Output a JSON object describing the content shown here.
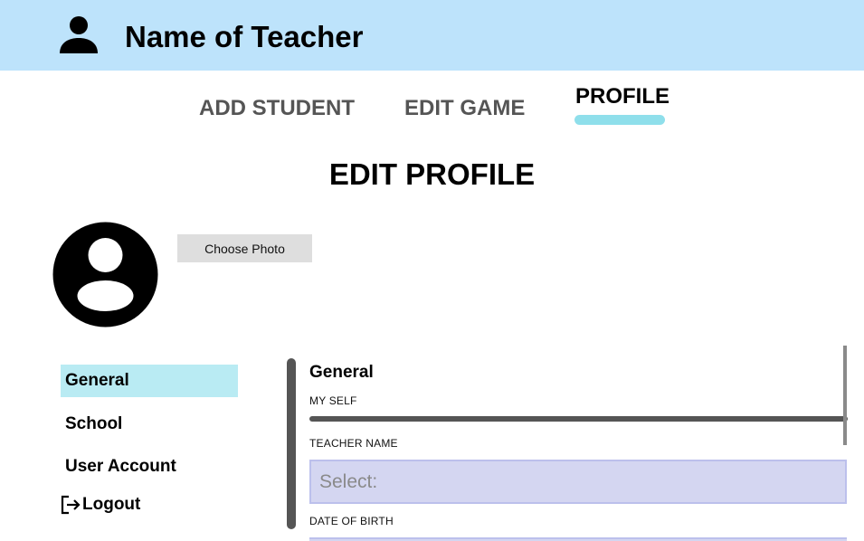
{
  "header": {
    "title": "Name of Teacher",
    "icon": "person-icon",
    "background": "#bde3fb"
  },
  "nav": {
    "tabs": [
      {
        "label": "ADD STUDENT",
        "active": false
      },
      {
        "label": "EDIT GAME",
        "active": false
      },
      {
        "label": "PROFILE",
        "active": true
      }
    ],
    "active_color": "#8fdfeb"
  },
  "page": {
    "title": "EDIT PROFILE"
  },
  "profile": {
    "avatar_icon": "account-circle-icon",
    "choose_photo_label": "Choose Photo"
  },
  "sidebar": {
    "items": [
      {
        "label": "General",
        "active": true
      },
      {
        "label": "School",
        "active": false
      },
      {
        "label": "User Account",
        "active": false
      },
      {
        "label": "Logout",
        "icon": "logout-icon",
        "active": false
      }
    ],
    "active_background": "#b9ebf3"
  },
  "form": {
    "section_title": "General",
    "fields": [
      {
        "label": "MY SELF"
      },
      {
        "label": "TEACHER NAME",
        "placeholder": "Select:"
      },
      {
        "label": "DATE OF BIRTH"
      }
    ],
    "input_background": "#d4d6f1"
  }
}
